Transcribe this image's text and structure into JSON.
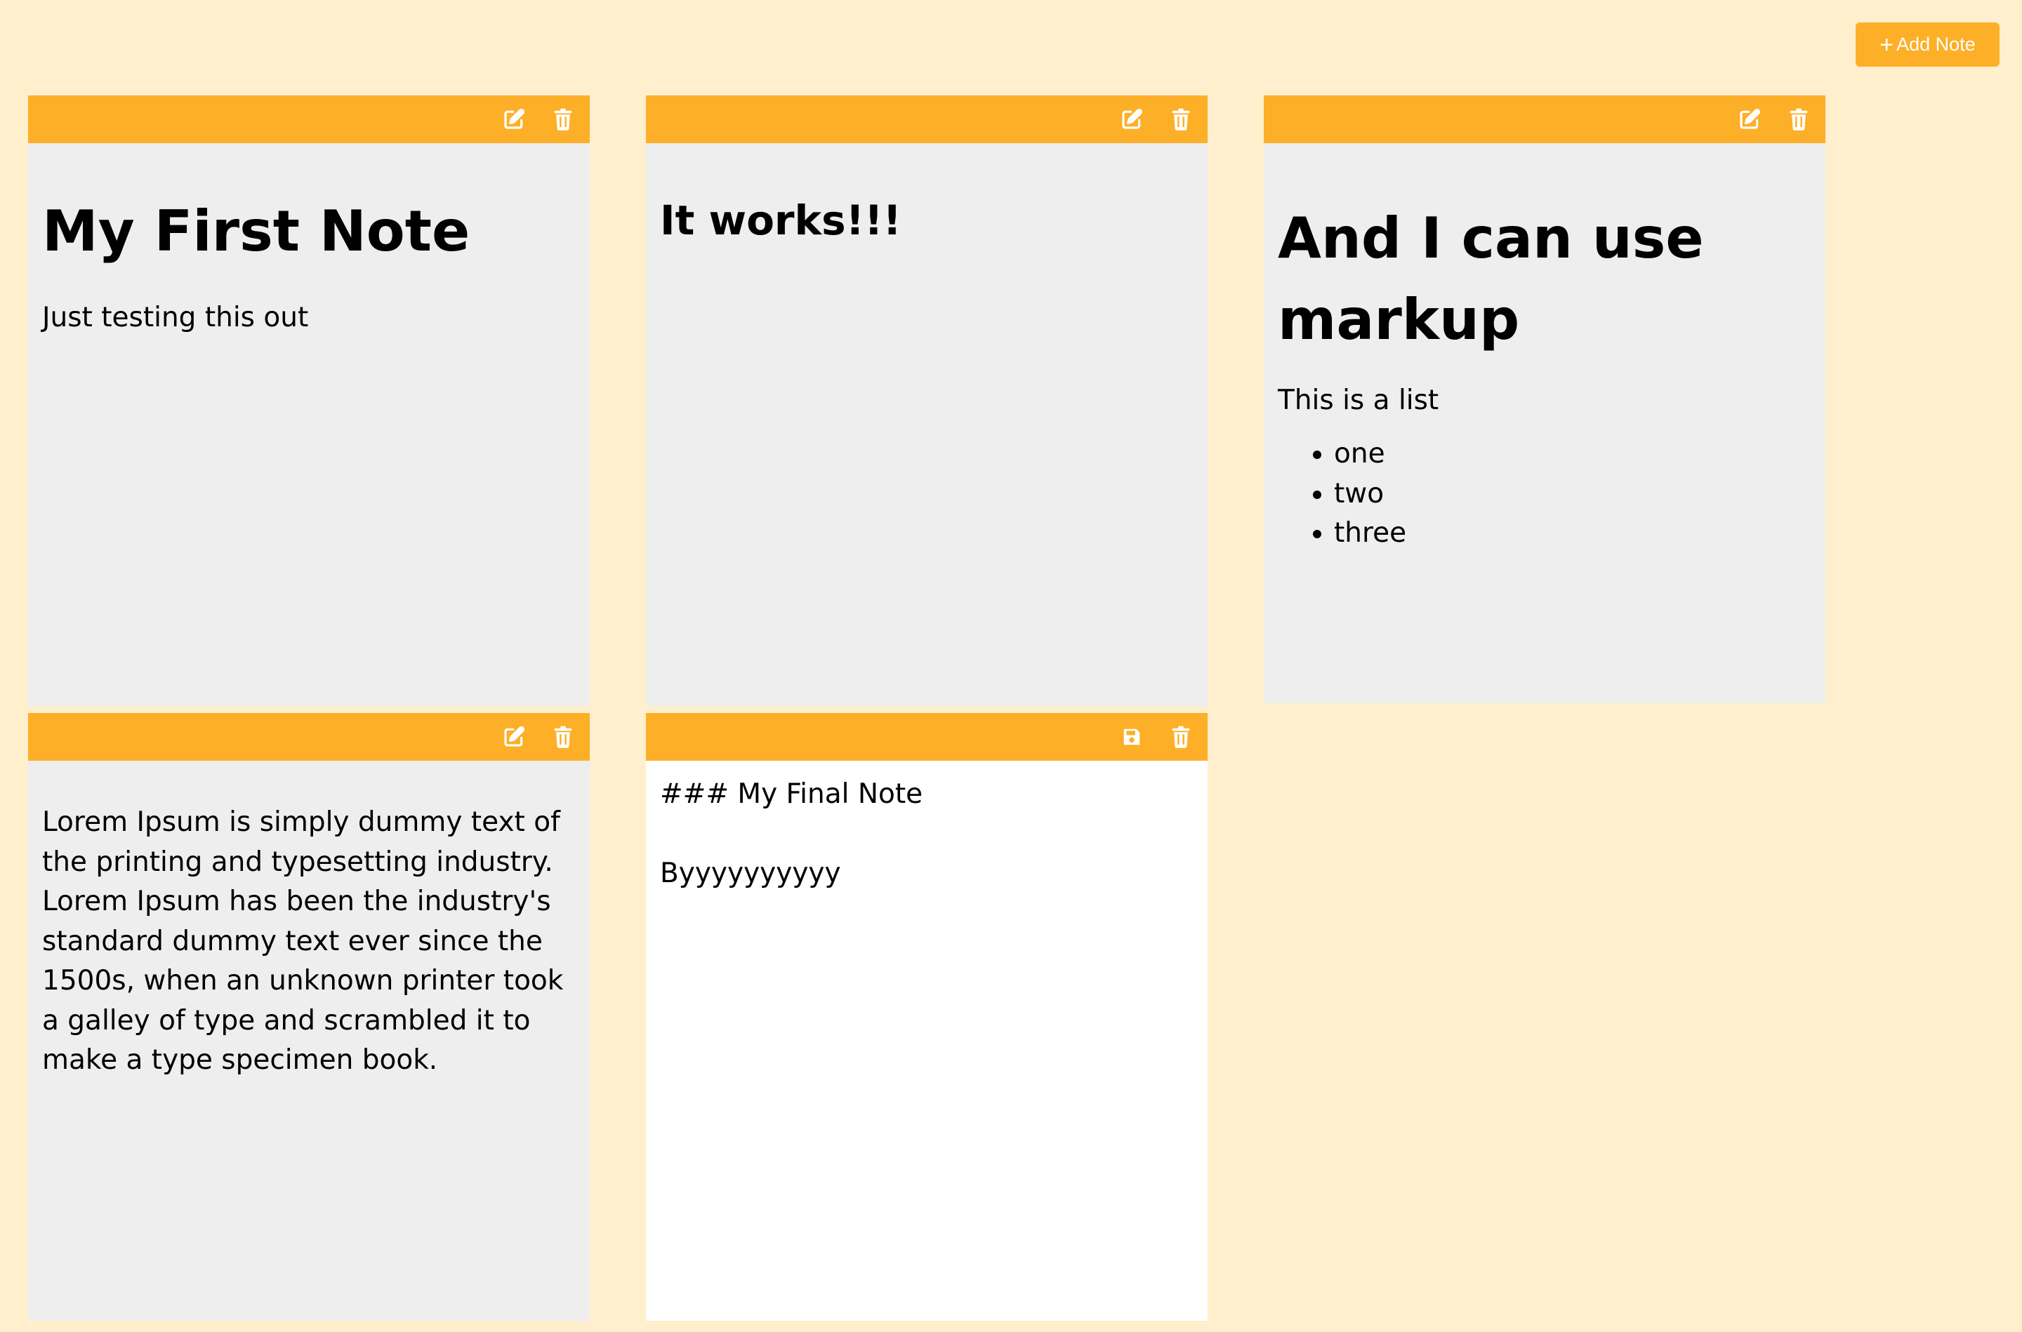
{
  "header": {
    "add_note_label": "Add Note",
    "add_icon": "plus-icon"
  },
  "colors": {
    "background": "#FFEFCD",
    "accent": "#FDAF27",
    "note_background": "#EEEEEE",
    "editor_background": "#FFFFFF"
  },
  "icons": {
    "edit": "edit-icon",
    "delete": "trash-icon",
    "save": "save-icon"
  },
  "notes": [
    {
      "mode": "view",
      "heading": "My First Note",
      "text": "Just testing this out"
    },
    {
      "mode": "view",
      "heading": "It works!!!"
    },
    {
      "mode": "view",
      "heading": "And I can use markup",
      "text": "This is a list",
      "list": [
        "one",
        "two",
        "three"
      ]
    },
    {
      "mode": "view",
      "text": "Lorem Ipsum is simply dummy text of the printing and typesetting industry. Lorem Ipsum has been the industry's standard dummy text ever since the 1500s, when an unknown printer took a galley of type and scrambled it to make a type specimen book."
    },
    {
      "mode": "edit",
      "source": "### My Final Note\n\nByyyyyyyyyy"
    }
  ]
}
